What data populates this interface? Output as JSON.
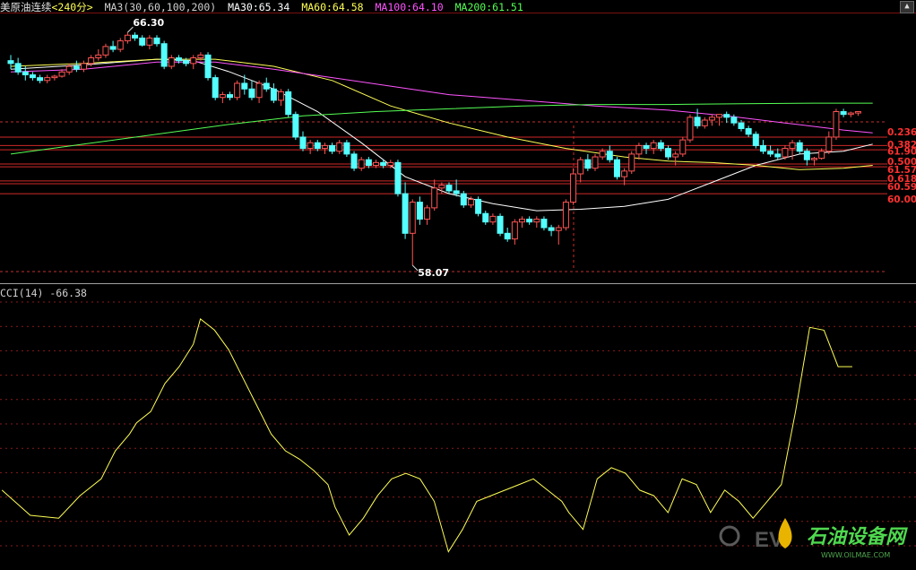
{
  "header": {
    "title": "美原油连续",
    "period": "<240分>",
    "ma_params": "MA3(30,60,100,200)",
    "ma30": "MA30:65.34",
    "ma60": "MA60:64.58",
    "ma100": "MA100:64.10",
    "ma200": "MA200:61.51",
    "colors": {
      "title": "#e0e0e0",
      "period": "#ffff54",
      "ma30": "#ffffff",
      "ma60": "#ffff54",
      "ma100": "#ff54ff",
      "ma200": "#54ff54"
    }
  },
  "cci_header": "CCI(14) -66.38",
  "watermark": {
    "brand": "石油设备网",
    "url": "WWW.OILMAE.COM"
  },
  "chart_data": [
    {
      "type": "candlestick",
      "ylim": [
        57.5,
        67.0
      ],
      "high_label": "66.30",
      "low_label": "58.07",
      "up_color": "#ff5454",
      "down_color": "#54ffff",
      "candles": [
        [
          65.3,
          65.5,
          65.0,
          65.2
        ],
        [
          65.2,
          65.4,
          64.8,
          64.9
        ],
        [
          64.9,
          65.1,
          64.6,
          64.8
        ],
        [
          64.8,
          64.9,
          64.6,
          64.7
        ],
        [
          64.7,
          64.8,
          64.5,
          64.6
        ],
        [
          64.6,
          64.8,
          64.5,
          64.7
        ],
        [
          64.7,
          64.8,
          64.6,
          64.75
        ],
        [
          64.75,
          65.0,
          64.7,
          64.9
        ],
        [
          64.9,
          65.2,
          64.8,
          65.1
        ],
        [
          65.1,
          65.3,
          64.9,
          65.0
        ],
        [
          65.0,
          65.3,
          64.9,
          65.2
        ],
        [
          65.2,
          65.5,
          65.1,
          65.4
        ],
        [
          65.4,
          65.7,
          65.3,
          65.5
        ],
        [
          65.5,
          65.9,
          65.4,
          65.8
        ],
        [
          65.8,
          66.0,
          65.6,
          65.7
        ],
        [
          65.7,
          66.1,
          65.6,
          66.0
        ],
        [
          66.0,
          66.3,
          65.9,
          66.2
        ],
        [
          66.2,
          66.3,
          66.0,
          66.1
        ],
        [
          66.1,
          66.2,
          65.8,
          65.85
        ],
        [
          65.85,
          66.2,
          65.7,
          66.1
        ],
        [
          66.1,
          66.2,
          65.8,
          65.9
        ],
        [
          65.9,
          66.0,
          65.0,
          65.1
        ],
        [
          65.1,
          65.5,
          65.0,
          65.4
        ],
        [
          65.4,
          65.5,
          65.2,
          65.3
        ],
        [
          65.3,
          65.4,
          65.1,
          65.2
        ],
        [
          65.2,
          65.5,
          65.0,
          65.4
        ],
        [
          65.4,
          65.6,
          65.3,
          65.5
        ],
        [
          65.5,
          65.6,
          64.6,
          64.7
        ],
        [
          64.7,
          64.8,
          63.9,
          64.0
        ],
        [
          64.0,
          64.2,
          63.8,
          64.1
        ],
        [
          64.1,
          64.2,
          63.9,
          64.0
        ],
        [
          64.0,
          64.6,
          63.9,
          64.5
        ],
        [
          64.5,
          64.8,
          64.1,
          64.3
        ],
        [
          64.3,
          64.6,
          63.9,
          64.0
        ],
        [
          64.0,
          64.6,
          63.8,
          64.5
        ],
        [
          64.5,
          64.7,
          64.2,
          64.3
        ],
        [
          64.3,
          64.5,
          63.8,
          63.9
        ],
        [
          63.9,
          64.3,
          63.7,
          64.2
        ],
        [
          64.2,
          64.3,
          63.3,
          63.4
        ],
        [
          63.4,
          63.5,
          62.5,
          62.6
        ],
        [
          62.6,
          62.8,
          62.1,
          62.2
        ],
        [
          62.2,
          62.5,
          62.0,
          62.4
        ],
        [
          62.4,
          62.5,
          62.1,
          62.2
        ],
        [
          62.2,
          62.4,
          62.0,
          62.3
        ],
        [
          62.3,
          62.4,
          62.0,
          62.1
        ],
        [
          62.1,
          62.5,
          62.0,
          62.4
        ],
        [
          62.4,
          62.5,
          61.9,
          62.0
        ],
        [
          62.0,
          62.1,
          61.4,
          61.5
        ],
        [
          61.5,
          61.9,
          61.4,
          61.8
        ],
        [
          61.8,
          61.9,
          61.5,
          61.6
        ],
        [
          61.6,
          61.8,
          61.5,
          61.7
        ],
        [
          61.7,
          61.8,
          61.5,
          61.6
        ],
        [
          61.6,
          61.8,
          61.5,
          61.7
        ],
        [
          61.7,
          61.8,
          60.5,
          60.6
        ],
        [
          60.6,
          61.0,
          59.0,
          59.2
        ],
        [
          59.2,
          60.4,
          58.07,
          60.3
        ],
        [
          60.3,
          60.5,
          59.5,
          59.7
        ],
        [
          59.7,
          60.2,
          59.5,
          60.1
        ],
        [
          60.1,
          61.1,
          60.0,
          60.8
        ],
        [
          60.8,
          61.0,
          60.6,
          60.9
        ],
        [
          60.9,
          61.0,
          60.6,
          60.7
        ],
        [
          60.7,
          61.1,
          60.5,
          60.6
        ],
        [
          60.6,
          60.7,
          60.1,
          60.2
        ],
        [
          60.2,
          60.5,
          60.1,
          60.4
        ],
        [
          60.4,
          60.5,
          59.8,
          59.9
        ],
        [
          59.9,
          60.0,
          59.5,
          59.6
        ],
        [
          59.6,
          59.9,
          59.5,
          59.8
        ],
        [
          59.8,
          59.9,
          59.1,
          59.2
        ],
        [
          59.2,
          59.4,
          58.9,
          59.0
        ],
        [
          59.0,
          59.7,
          58.8,
          59.6
        ],
        [
          59.6,
          59.8,
          59.4,
          59.7
        ],
        [
          59.7,
          59.8,
          59.5,
          59.6
        ],
        [
          59.6,
          59.8,
          59.4,
          59.7
        ],
        [
          59.7,
          59.8,
          59.3,
          59.4
        ],
        [
          59.4,
          59.5,
          59.1,
          59.3
        ],
        [
          59.3,
          59.5,
          58.8,
          59.4
        ],
        [
          59.4,
          60.4,
          59.3,
          60.3
        ],
        [
          60.3,
          61.5,
          60.2,
          61.3
        ],
        [
          61.3,
          61.9,
          61.0,
          61.8
        ],
        [
          61.8,
          62.0,
          61.4,
          61.5
        ],
        [
          61.5,
          62.0,
          61.4,
          61.9
        ],
        [
          61.9,
          62.2,
          61.8,
          62.1
        ],
        [
          62.1,
          62.3,
          61.7,
          61.8
        ],
        [
          61.8,
          61.9,
          61.1,
          61.2
        ],
        [
          61.2,
          61.5,
          60.9,
          61.4
        ],
        [
          61.4,
          62.1,
          61.3,
          62.0
        ],
        [
          62.0,
          62.4,
          61.8,
          62.3
        ],
        [
          62.3,
          62.4,
          62.0,
          62.2
        ],
        [
          62.2,
          62.5,
          62.0,
          62.4
        ],
        [
          62.4,
          62.5,
          62.1,
          62.2
        ],
        [
          62.2,
          62.3,
          61.8,
          61.9
        ],
        [
          61.9,
          62.1,
          61.6,
          62.0
        ],
        [
          62.0,
          62.6,
          61.9,
          62.5
        ],
        [
          62.5,
          63.4,
          62.4,
          63.3
        ],
        [
          63.3,
          63.6,
          62.9,
          63.0
        ],
        [
          63.0,
          63.3,
          62.9,
          63.2
        ],
        [
          63.2,
          63.4,
          63.0,
          63.3
        ],
        [
          63.3,
          63.4,
          63.0,
          63.4
        ],
        [
          63.4,
          63.5,
          63.1,
          63.3
        ],
        [
          63.3,
          63.4,
          63.0,
          63.1
        ],
        [
          63.1,
          63.2,
          62.8,
          62.9
        ],
        [
          62.9,
          63.0,
          62.6,
          62.7
        ],
        [
          62.7,
          62.8,
          62.2,
          62.3
        ],
        [
          62.3,
          62.5,
          62.0,
          62.1
        ],
        [
          62.1,
          62.3,
          61.9,
          62.0
        ],
        [
          62.0,
          62.2,
          61.8,
          61.9
        ],
        [
          61.9,
          62.3,
          61.8,
          62.2
        ],
        [
          62.2,
          62.5,
          61.8,
          62.4
        ],
        [
          62.4,
          62.5,
          62.0,
          62.1
        ],
        [
          62.1,
          62.2,
          61.6,
          61.8
        ],
        [
          61.8,
          61.9,
          61.6,
          61.85
        ],
        [
          61.85,
          62.2,
          61.8,
          62.1
        ],
        [
          62.1,
          62.8,
          62.0,
          62.6
        ],
        [
          62.6,
          63.6,
          62.5,
          63.5
        ],
        [
          63.5,
          63.6,
          63.3,
          63.4
        ],
        [
          63.4,
          63.5,
          63.3,
          63.45
        ],
        [
          63.45,
          63.5,
          63.35,
          63.5
        ]
      ],
      "moving_averages": [
        {
          "name": "MA30",
          "color": "#ffffff",
          "values": [
            [
              0,
              65.0
            ],
            [
              10,
              65.15
            ],
            [
              20,
              65.35
            ],
            [
              25,
              65.3
            ],
            [
              30,
              64.9
            ],
            [
              36,
              64.3
            ],
            [
              42,
              63.5
            ],
            [
              48,
              62.4
            ],
            [
              54,
              61.2
            ],
            [
              60,
              60.6
            ],
            [
              66,
              60.25
            ],
            [
              72,
              60.0
            ],
            [
              78,
              60.05
            ],
            [
              84,
              60.15
            ],
            [
              90,
              60.4
            ],
            [
              96,
              61.0
            ],
            [
              102,
              61.6
            ],
            [
              108,
              62.0
            ],
            [
              114,
              62.1
            ],
            [
              118,
              62.35
            ]
          ]
        },
        {
          "name": "MA60",
          "color": "#ffff54",
          "values": [
            [
              0,
              65.1
            ],
            [
              10,
              65.2
            ],
            [
              20,
              65.35
            ],
            [
              28,
              65.35
            ],
            [
              36,
              65.1
            ],
            [
              44,
              64.6
            ],
            [
              52,
              63.7
            ],
            [
              60,
              63.1
            ],
            [
              68,
              62.6
            ],
            [
              76,
              62.2
            ],
            [
              84,
              61.9
            ],
            [
              90,
              61.75
            ],
            [
              96,
              61.7
            ],
            [
              102,
              61.6
            ],
            [
              108,
              61.45
            ],
            [
              114,
              61.5
            ],
            [
              118,
              61.6
            ]
          ]
        },
        {
          "name": "MA100",
          "color": "#ff54ff",
          "values": [
            [
              0,
              64.9
            ],
            [
              10,
              65.0
            ],
            [
              20,
              65.25
            ],
            [
              28,
              65.25
            ],
            [
              36,
              65.0
            ],
            [
              44,
              64.7
            ],
            [
              52,
              64.4
            ],
            [
              60,
              64.1
            ],
            [
              70,
              63.9
            ],
            [
              80,
              63.7
            ],
            [
              90,
              63.55
            ],
            [
              98,
              63.35
            ],
            [
              106,
              63.1
            ],
            [
              114,
              62.85
            ],
            [
              118,
              62.75
            ]
          ]
        },
        {
          "name": "MA200",
          "color": "#54ff54",
          "values": [
            [
              0,
              62.0
            ],
            [
              10,
              62.35
            ],
            [
              20,
              62.7
            ],
            [
              30,
              63.05
            ],
            [
              40,
              63.35
            ],
            [
              50,
              63.5
            ],
            [
              60,
              63.6
            ],
            [
              70,
              63.7
            ],
            [
              80,
              63.75
            ],
            [
              90,
              63.75
            ],
            [
              100,
              63.78
            ],
            [
              110,
              63.8
            ],
            [
              118,
              63.8
            ]
          ]
        }
      ],
      "fib_levels": [
        {
          "label": "0.236",
          "price": 62.6
        },
        {
          "label": "61.90",
          "price": 62.3
        },
        {
          "label": "0.382",
          "price": 62.15
        },
        {
          "label": "61.57",
          "price": 61.65
        },
        {
          "label": "0.500",
          "price": 61.55
        },
        {
          "label": "60.59",
          "price": 61.05
        },
        {
          "label": "0.618",
          "price": 60.95
        },
        {
          "label": "60.00",
          "price": 60.6
        }
      ]
    },
    {
      "type": "line",
      "title": "CCI(14) -66.38",
      "color": "#ffff54",
      "ylim": [
        -230,
        230
      ],
      "values": [
        [
          0,
          -110
        ],
        [
          4,
          -155
        ],
        [
          8,
          -160
        ],
        [
          11,
          -120
        ],
        [
          14,
          -90
        ],
        [
          16,
          -40
        ],
        [
          18,
          -10
        ],
        [
          19,
          10
        ],
        [
          21,
          30
        ],
        [
          23,
          80
        ],
        [
          25,
          110
        ],
        [
          27,
          150
        ],
        [
          28,
          195
        ],
        [
          30,
          175
        ],
        [
          32,
          140
        ],
        [
          34,
          90
        ],
        [
          36,
          40
        ],
        [
          38,
          -10
        ],
        [
          40,
          -40
        ],
        [
          42,
          -55
        ],
        [
          44,
          -75
        ],
        [
          46,
          -100
        ],
        [
          47,
          -140
        ],
        [
          49,
          -190
        ],
        [
          51,
          -160
        ],
        [
          53,
          -120
        ],
        [
          55,
          -90
        ],
        [
          57,
          -80
        ],
        [
          59,
          -90
        ],
        [
          61,
          -130
        ],
        [
          63,
          -220
        ],
        [
          65,
          -180
        ],
        [
          67,
          -130
        ],
        [
          69,
          -120
        ],
        [
          71,
          -110
        ],
        [
          73,
          -100
        ],
        [
          75,
          -90
        ],
        [
          77,
          -110
        ],
        [
          79,
          -130
        ],
        [
          80,
          -150
        ],
        [
          82,
          -180
        ],
        [
          84,
          -90
        ],
        [
          86,
          -70
        ],
        [
          88,
          -80
        ],
        [
          90,
          -110
        ],
        [
          92,
          -120
        ],
        [
          94,
          -150
        ],
        [
          96,
          -90
        ],
        [
          98,
          -100
        ],
        [
          100,
          -150
        ],
        [
          102,
          -110
        ],
        [
          104,
          -130
        ],
        [
          106,
          -160
        ],
        [
          108,
          -130
        ],
        [
          110,
          -100
        ],
        [
          112,
          30
        ],
        [
          114,
          180
        ],
        [
          116,
          175
        ],
        [
          118,
          110
        ],
        [
          120,
          110
        ]
      ]
    }
  ]
}
